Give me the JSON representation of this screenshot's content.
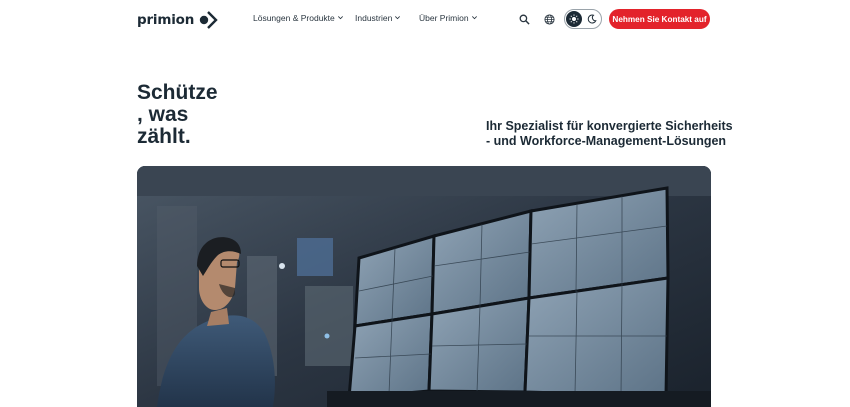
{
  "header": {
    "logo_text": "primion",
    "nav": [
      {
        "label": "Lösungen & Produkte"
      },
      {
        "label": "Industrien"
      },
      {
        "label": "Über Primion"
      }
    ],
    "icons": {
      "search": "search-icon",
      "language": "globe-icon",
      "theme_light": "sun-icon",
      "theme_dark": "moon-icon"
    },
    "theme_selected": "light",
    "cta_label": "Nehmen Sie Kontakt auf"
  },
  "hero": {
    "title_lines": [
      "Schütze",
      ", was",
      "zählt."
    ],
    "subtitle_lines": [
      "Ihr Spezialist für konvergierte Sicherheits",
      "- und Workforce-Management-Lösungen"
    ],
    "image": "control-room-operator-monitors"
  },
  "colors": {
    "brand_red": "#e3232b",
    "text_dark": "#1c2a35",
    "background": "#ffffff"
  }
}
